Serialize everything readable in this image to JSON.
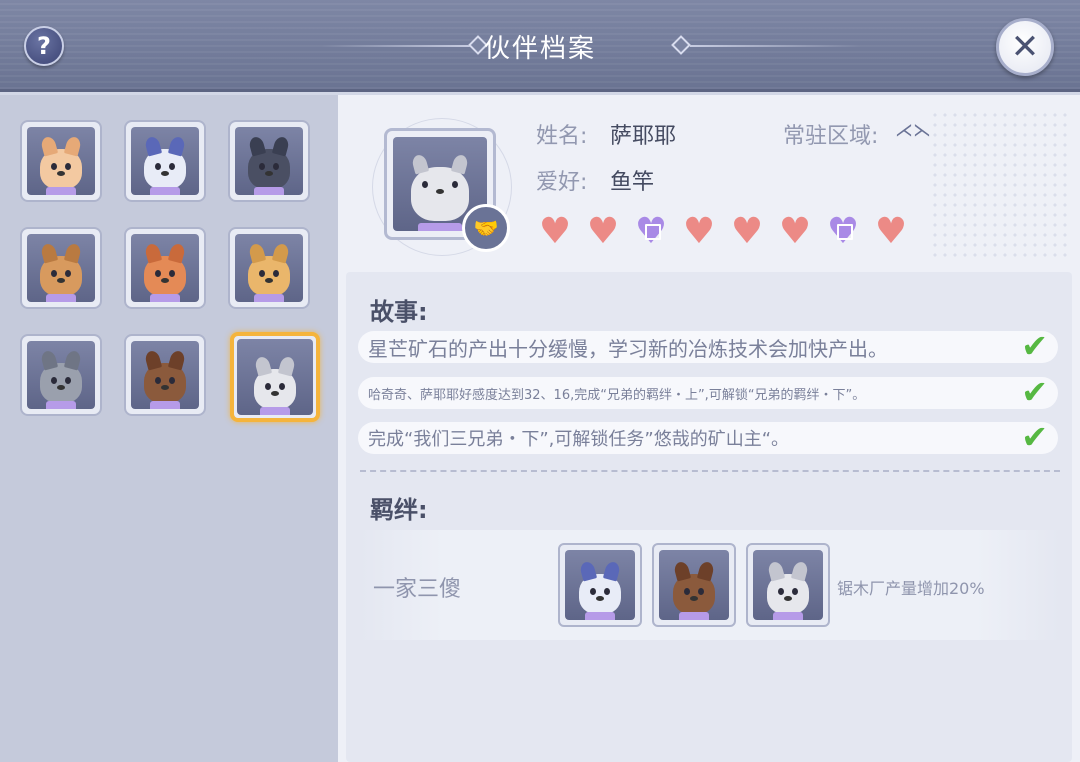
{
  "header": {
    "title": "伙伴档案",
    "help_label": "?",
    "close_label": "✕"
  },
  "partners": [
    {
      "name": "sheep",
      "fur": "#f3c9a1",
      "ear": "#e6a977",
      "hair": "#b9e6b1"
    },
    {
      "name": "husky",
      "fur": "#e8ecf7",
      "ear": "#5a68b8"
    },
    {
      "name": "gorilla",
      "fur": "#4a4f63",
      "ear": "#3a3f52"
    },
    {
      "name": "deer",
      "fur": "#d89a5e",
      "ear": "#b97a41"
    },
    {
      "name": "fox",
      "fur": "#e48a56",
      "ear": "#c96a3b"
    },
    {
      "name": "corgi",
      "fur": "#eab66b",
      "ear": "#d39a4b"
    },
    {
      "name": "wolf-grey",
      "fur": "#9aa0ad",
      "ear": "#6f7585"
    },
    {
      "name": "brown-dog",
      "fur": "#8b5a3c",
      "ear": "#6d4029"
    },
    {
      "name": "sayeye",
      "fur": "#e6e7ec",
      "ear": "#c3c5cf",
      "selected": true
    }
  ],
  "profile": {
    "name_label": "姓名:",
    "name_value": "萨耶耶",
    "region_label": "常驻区域:",
    "hobby_label": "爱好:",
    "hobby_value": "鱼竿",
    "hearts": [
      "full",
      "full",
      "gift",
      "full",
      "full",
      "full",
      "gift",
      "full"
    ]
  },
  "story": {
    "title": "故事:",
    "items": [
      {
        "text": "星芒矿石的产出十分缓慢，学习新的冶炼技术会加快产出。",
        "done": true
      },
      {
        "text": "哈奇奇、萨耶耶好感度达到32、16,完成“兄弟的羁绊・上”,可解锁“兄弟的羁绊・下”。",
        "done": true
      },
      {
        "text": "完成“我们三兄弟・下”,可解锁任务”悠哉的矿山主“。",
        "done": true
      }
    ]
  },
  "bond": {
    "title": "羁绊:",
    "name": "一家三傻",
    "effect": "锯木厂产量增加20%",
    "members": [
      "husky",
      "brown-dog",
      "sayeye"
    ]
  },
  "colors": {
    "header": "#727b99",
    "heart": "#ec8a86",
    "gift_heart": "#a98ae6",
    "check": "#56b842",
    "selected_border": "#f5b43c"
  }
}
